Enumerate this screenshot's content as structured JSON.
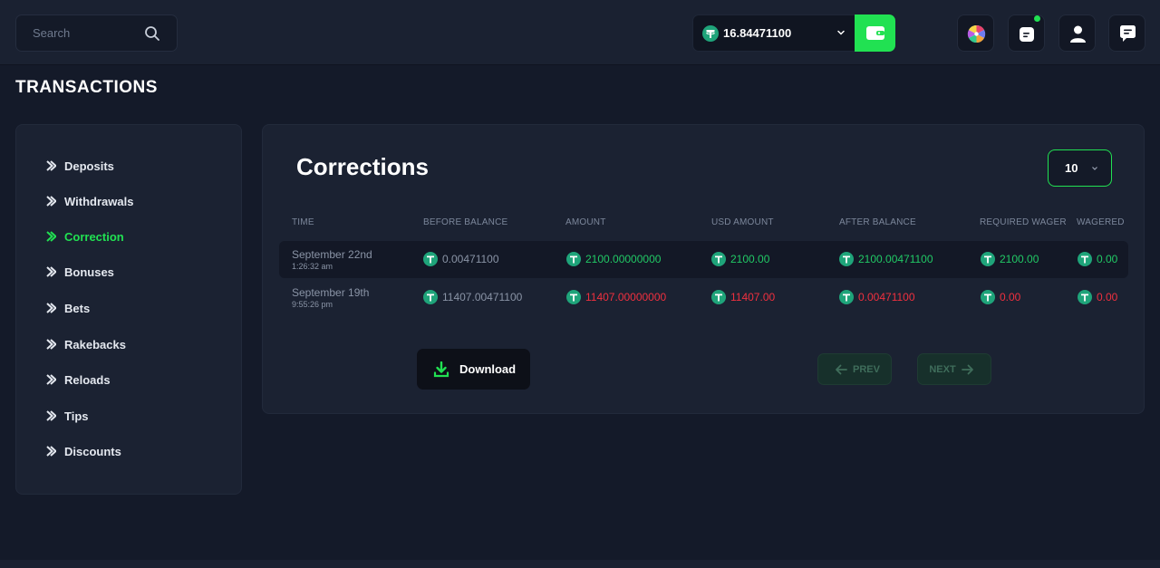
{
  "header": {
    "search_placeholder": "Search",
    "balance": "16.84471100",
    "icons": [
      "search-icon",
      "tether-coin-icon",
      "chevron-down-icon",
      "wallet-icon",
      "wheel-icon",
      "rewards-icon",
      "user-icon",
      "chat-icon"
    ]
  },
  "page_title": "TRANSACTIONS",
  "sidebar": {
    "items": [
      {
        "label": "Deposits",
        "active": false
      },
      {
        "label": "Withdrawals",
        "active": false
      },
      {
        "label": "Correction",
        "active": true
      },
      {
        "label": "Bonuses",
        "active": false
      },
      {
        "label": "Bets",
        "active": false
      },
      {
        "label": "Rakebacks",
        "active": false
      },
      {
        "label": "Reloads",
        "active": false
      },
      {
        "label": "Tips",
        "active": false
      },
      {
        "label": "Discounts",
        "active": false
      }
    ]
  },
  "main": {
    "title": "Corrections",
    "per_page": "10",
    "columns": [
      "TIME",
      "BEFORE BALANCE",
      "AMOUNT",
      "USD AMOUNT",
      "AFTER BALANCE",
      "REQUIRED WAGER",
      "WAGERED"
    ],
    "rows": [
      {
        "date": "September 22nd",
        "time": "1:26:32 am",
        "before_balance": "0.00471100",
        "amount": "2100.00000000",
        "usd_amount": "2100.00",
        "after_balance": "2100.00471100",
        "required_wager": "2100.00",
        "wagered": "0.00",
        "tone": "green"
      },
      {
        "date": "September 19th",
        "time": "9:55:26 pm",
        "before_balance": "11407.00471100",
        "amount": "11407.00000000",
        "usd_amount": "11407.00",
        "after_balance": "0.00471100",
        "required_wager": "0.00",
        "wagered": "0.00",
        "tone": "red"
      }
    ],
    "download_label": "Download",
    "prev_label": "PREV",
    "next_label": "NEXT"
  },
  "colors": {
    "accent": "#21e152",
    "positive": "#21c965",
    "negative": "#f0303f",
    "background": "#141a29",
    "panel": "#1b2232"
  }
}
